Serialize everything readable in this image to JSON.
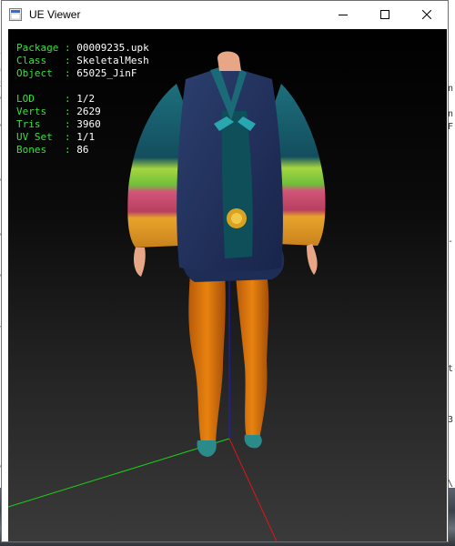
{
  "window": {
    "title": "UE Viewer"
  },
  "info": [
    {
      "key": "Package",
      "sep": " : ",
      "value": "00009235.upk"
    },
    {
      "key": "Class  ",
      "sep": " : ",
      "value": "SkeletalMesh"
    },
    {
      "key": "Object ",
      "sep": " : ",
      "value": "65025_JinF"
    },
    {
      "key": "",
      "sep": "",
      "value": ""
    },
    {
      "key": "LOD    ",
      "sep": " : ",
      "value": "1/2"
    },
    {
      "key": "Verts  ",
      "sep": " : ",
      "value": "2629"
    },
    {
      "key": "Tris   ",
      "sep": " : ",
      "value": "3960"
    },
    {
      "key": "UV Set ",
      "sep": " : ",
      "value": "1/1"
    },
    {
      "key": "Bones  ",
      "sep": " : ",
      "value": "86"
    }
  ],
  "background": {
    "left_glyphs": [
      "l",
      "u",
      "5",
      "e",
      "",
      "e",
      "]",
      "",
      "",
      "e",
      "",
      "]",
      "",
      "e",
      "]",
      "",
      "e",
      "",
      "",
      "]",
      "T",
      "]",
      "",
      "]",
      "",
      "]",
      "",
      "]",
      "",
      "]",
      "e",
      ""
    ],
    "right_glyphs": [
      "n",
      "",
      "n",
      "F",
      "",
      "",
      "",
      "",
      "",
      "",
      "",
      "",
      "-",
      "",
      "",
      "",
      "",
      "",
      "",
      "",
      "",
      "",
      "t",
      "",
      "",
      "",
      "3",
      "",
      "",
      "",
      "",
      "\\"
    ]
  },
  "icons": {
    "app": "ue-viewer-app-icon",
    "minimize": "minimize-icon",
    "maximize": "maximize-icon",
    "close": "close-icon"
  }
}
